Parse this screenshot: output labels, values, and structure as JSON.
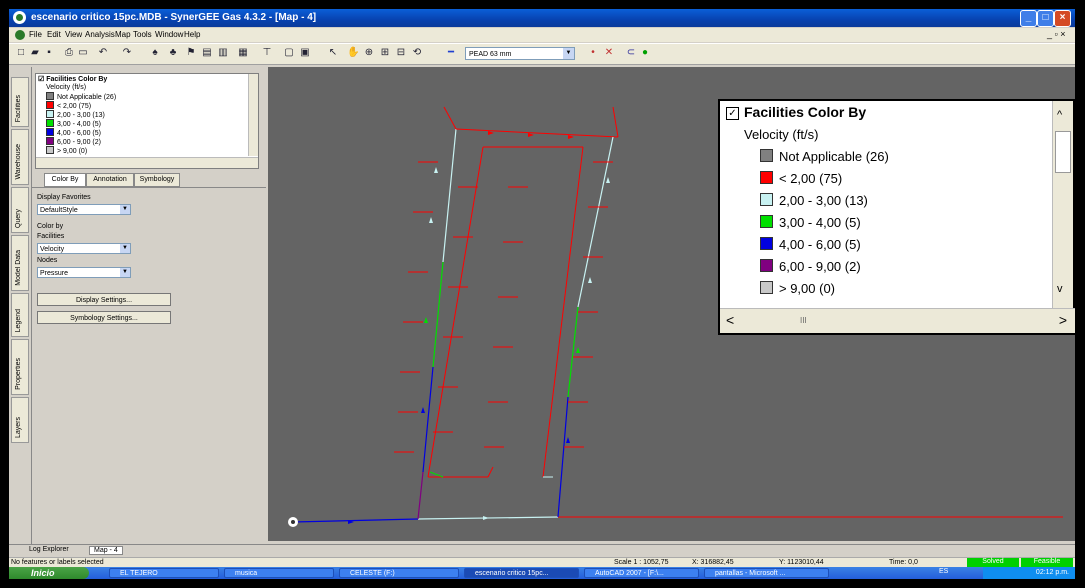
{
  "window": {
    "title": "escenario critico 15pc.MDB - SynerGEE Gas 4.3.2 - [Map - 4]"
  },
  "menu": [
    "File",
    "Edit",
    "View",
    "Analysis",
    "Map",
    "Tools",
    "Window",
    "Help"
  ],
  "toolbar": {
    "pipe_combo": "PEAD 63 mm"
  },
  "vertical_tabs": [
    "Facilities",
    "Warehouse",
    "Query",
    "Model Data",
    "Legend",
    "Properties",
    "Layers"
  ],
  "legend": {
    "title": "Facilities Color By",
    "subtitle": "Velocity (ft/s)",
    "scroll_mark": "III",
    "items": [
      {
        "label": "Not Applicable (26)",
        "color": "#808080"
      },
      {
        "label": "< 2,00  (75)",
        "color": "#ff0000"
      },
      {
        "label": "2,00 - 3,00  (13)",
        "color": "#c8f2f2"
      },
      {
        "label": "3,00 - 4,00  (5)",
        "color": "#00e000"
      },
      {
        "label": "4,00 - 6,00  (5)",
        "color": "#0000e0"
      },
      {
        "label": "6,00 - 9,00  (2)",
        "color": "#800080"
      },
      {
        "label": "> 9,00  (0)",
        "color": "#c8c8c8"
      }
    ]
  },
  "legend_small": {
    "title": "Facilities Color By",
    "subtitle": "Velocity (ft/s)",
    "items": [
      "Not Applicable (26)",
      "< 2,00 (75)",
      "2,00 - 3,00 (13)",
      "3,00 - 4,00 (5)",
      "4,00 - 6,00 (5)",
      "6,00 - 9,00 (2)",
      "> 9,00 (0)"
    ]
  },
  "panel_tabs": [
    "Color By",
    "Annotation",
    "Symbology"
  ],
  "form": {
    "display_favorites_label": "Display Favorites",
    "display_favorites_value": "DefaultStyle",
    "color_by_label": "Color by",
    "facilities_label": "Facilities",
    "facilities_value": "Velocity",
    "nodes_label": "Nodes",
    "nodes_value": "Pressure",
    "display_settings": "Display Settings...",
    "symbology_settings": "Symbology Settings..."
  },
  "bottom_tabs": [
    "Log Explorer",
    "Map - 4"
  ],
  "status": {
    "message": "No features or labels selected",
    "scale": "Scale  1 : 1052,75",
    "x": "X: 316882,45",
    "y": "Y: 1123010,44",
    "time": "Time: 0,0",
    "solved": "Solved",
    "feasible": "Feasible"
  },
  "taskbar": {
    "start": "Inicio",
    "items": [
      "EL TEJERO",
      "musica",
      "CELESTE (F:)",
      "escenario critico 15pc...",
      "AutoCAD 2007 - [F:\\...",
      "pantallas - Microsoft ..."
    ],
    "lang": "ES",
    "clock": "02:12 p.m."
  },
  "colors": {
    "red": "#ff0000",
    "cyan": "#c8f2f2",
    "green": "#00e000",
    "blue": "#0000e0",
    "purple": "#800080",
    "gray": "#808080"
  }
}
